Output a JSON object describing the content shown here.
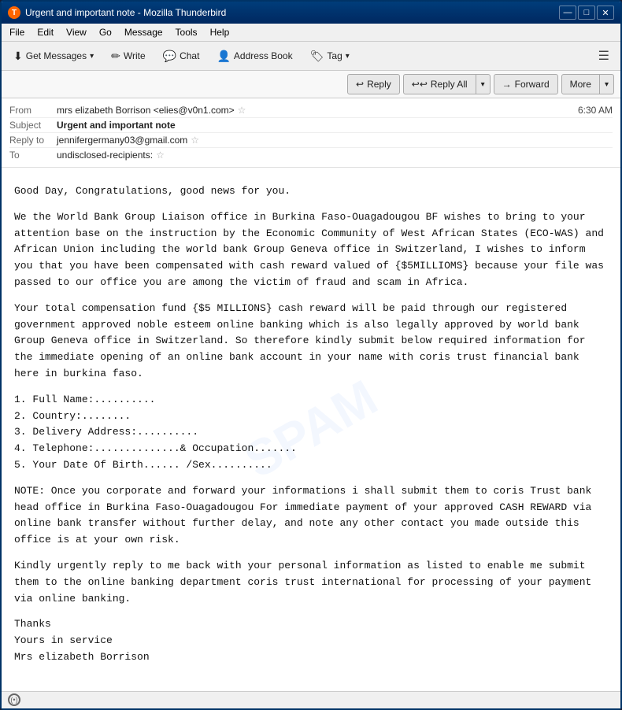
{
  "window": {
    "title": "Urgent and important note - Mozilla Thunderbird",
    "icon": "T"
  },
  "titlebar": {
    "controls": {
      "minimize": "—",
      "maximize": "□",
      "close": "✕"
    }
  },
  "menubar": {
    "items": [
      {
        "label": "File"
      },
      {
        "label": "Edit"
      },
      {
        "label": "View"
      },
      {
        "label": "Go"
      },
      {
        "label": "Message"
      },
      {
        "label": "Tools"
      },
      {
        "label": "Help"
      }
    ]
  },
  "toolbar": {
    "get_messages": "Get Messages",
    "write": "Write",
    "chat": "Chat",
    "address_book": "Address Book",
    "tag": "Tag",
    "tag_arrow": "▾"
  },
  "action_buttons": {
    "reply": "Reply",
    "reply_all": "Reply All",
    "reply_all_arrow": "▾",
    "forward": "Forward",
    "more": "More",
    "more_arrow": "▾"
  },
  "email_header": {
    "from_label": "From",
    "from_value": "mrs elizabeth Borrison <elies@v0n1.com>",
    "subject_label": "Subject",
    "subject_value": "Urgent and important note",
    "time": "6:30 AM",
    "reply_to_label": "Reply to",
    "reply_to_value": "jennifergermany03@gmail.com",
    "to_label": "To",
    "to_value": "undisclosed-recipients:"
  },
  "email_body": {
    "paragraphs": [
      "Good Day, Congratulations, good news for you.",
      "We the World Bank Group Liaison office in Burkina Faso-Ouagadougou BF wishes to bring to your attention base on the instruction by the Economic Community of West African States (ECO-WAS) and African Union including the world bank Group Geneva office in Switzerland, I wishes to inform you that you have been compensated with cash reward valued of {$5MILLIOMS} because your file was passed to our office you are among the victim of fraud and scam in Africa.",
      "Your total compensation fund {$5 MILLIONS} cash reward will be paid through our registered government approved noble esteem online banking  which is also legally approved by world bank Group Geneva office in Switzerland.  So therefore kindly submit below required information for the immediate opening of an online bank account in your name with coris trust financial bank here in burkina faso.",
      "1. Full Name:..........\n2. Country:........\n3. Delivery Address:..........\n4. Telephone:..............& Occupation.......\n5. Your Date Of Birth...... /Sex..........",
      "NOTE:  Once you corporate and forward your informations i shall submit them to coris Trust bank head office in Burkina Faso-Ouagadougou For immediate payment of your approved CASH REWARD via online bank transfer without further delay,  and note any other contact you made outside this office is at your own risk.",
      "Kindly urgently reply to me back with your personal information as listed to enable me submit them to the online banking department coris trust international for processing of your payment via online banking.",
      "Thanks\nYours in service\nMrs elizabeth Borrison"
    ]
  },
  "statusbar": {
    "icon": "((•))",
    "text": ""
  }
}
